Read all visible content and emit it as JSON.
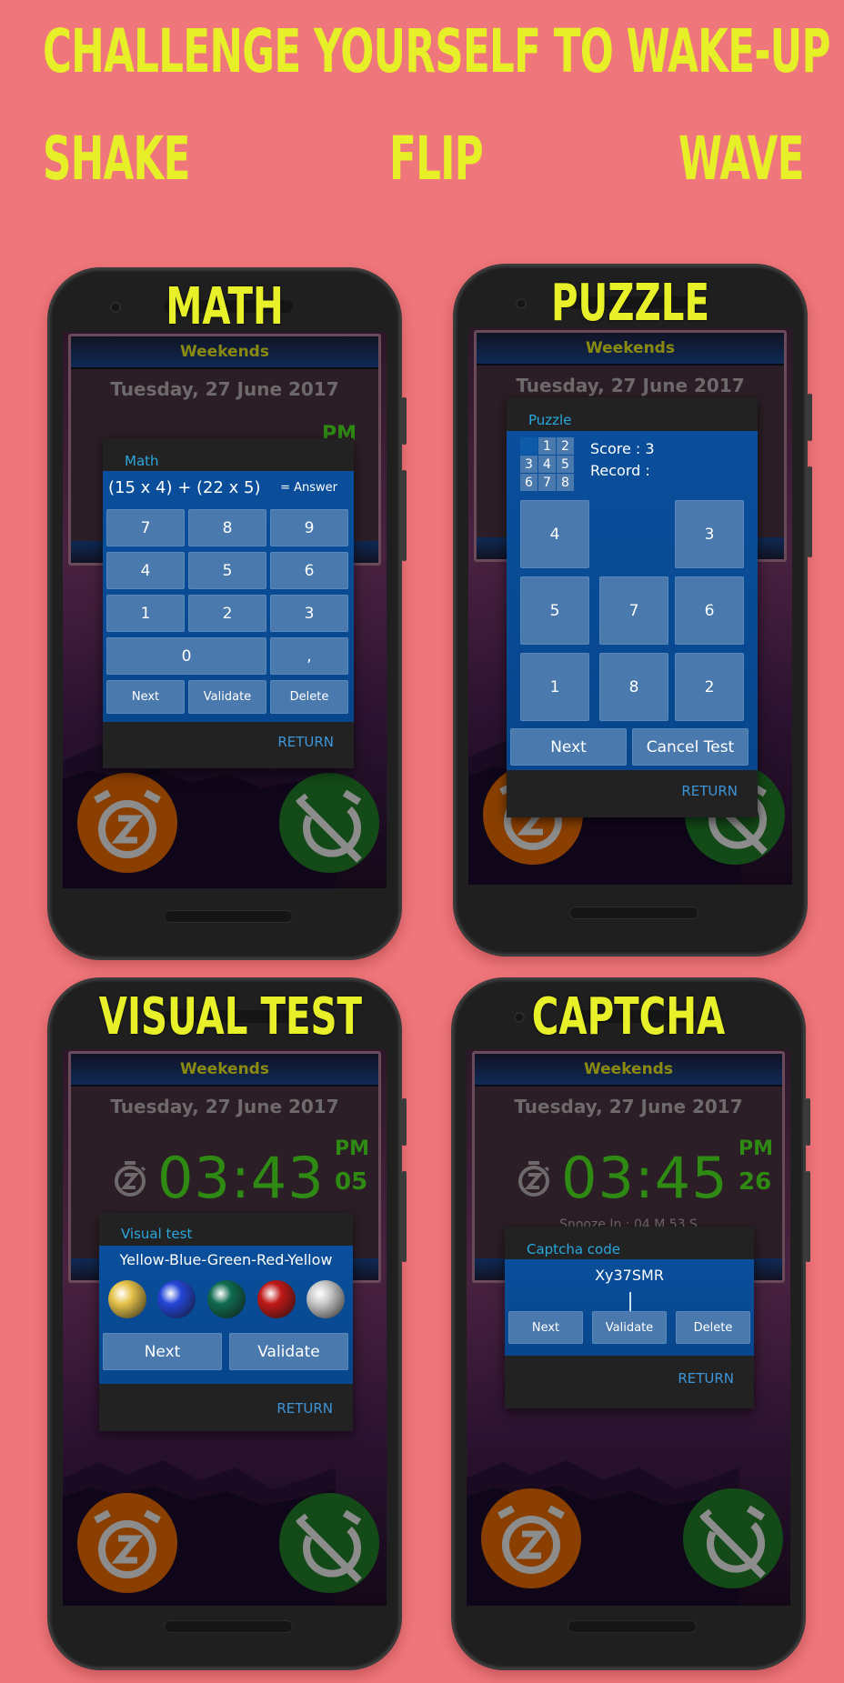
{
  "headline": {
    "title": "CHALLENGE YOURSELF TO WAKE-UP",
    "modes": [
      "SHAKE",
      "FLIP",
      "WAVE"
    ]
  },
  "colors": {
    "background": "#ef767b",
    "headline": "#e6ef27",
    "dialog_blue": "#0a4f9c",
    "key_blue": "#4a79ad",
    "clock_green": "#2e8a12",
    "link_blue": "#3e95d8",
    "snooze_orange": "#8a3f00",
    "dismiss_green": "#134a17"
  },
  "alarm_screen": {
    "header": "Weekends",
    "date": "Tuesday,  27  June  2017"
  },
  "phones": [
    {
      "label": "MATH",
      "clock": {
        "ampm": "PM"
      },
      "dialog": {
        "title": "Math",
        "expression": "(15 x 4) + (22 x 5)",
        "answer_placeholder": "=  Answer",
        "keys": [
          "7",
          "8",
          "9",
          "4",
          "5",
          "6",
          "1",
          "2",
          "3",
          "0",
          ","
        ],
        "actions": [
          "Next",
          "Validate",
          "Delete"
        ],
        "return_label": "RETURN"
      },
      "snooze_icon": "alarm-snooze-icon",
      "dismiss_icon": "alarm-off-icon"
    },
    {
      "label": "PUZZLE",
      "dialog": {
        "title": "Puzzle",
        "target_grid": [
          "",
          "1",
          "2",
          "3",
          "4",
          "5",
          "6",
          "7",
          "8"
        ],
        "score_label": "Score : 3",
        "record_label": "Record :",
        "tiles": [
          "4",
          "",
          "3",
          "5",
          "7",
          "6",
          "1",
          "8",
          "2"
        ],
        "actions": [
          "Next",
          "Cancel Test"
        ],
        "return_label": "RETURN"
      },
      "snooze_icon": "alarm-snooze-icon",
      "dismiss_icon": "alarm-off-icon"
    },
    {
      "label": "VISUAL TEST",
      "clock": {
        "time": "03:43",
        "ampm": "PM",
        "seconds": "05"
      },
      "dialog": {
        "title": "Visual test",
        "sequence": "Yellow-Blue-Green-Red-Yellow",
        "balls": [
          {
            "name": "yellow",
            "color": "#e6c24a"
          },
          {
            "name": "blue",
            "color": "#2446d8"
          },
          {
            "name": "green",
            "color": "#0f6b4f"
          },
          {
            "name": "red",
            "color": "#c01818"
          },
          {
            "name": "white",
            "color": "#c9c9c9"
          }
        ],
        "actions": [
          "Next",
          "Validate"
        ],
        "return_label": "RETURN"
      },
      "snooze_icon": "alarm-snooze-icon",
      "dismiss_icon": "alarm-off-icon"
    },
    {
      "label": "CAPTCHA",
      "clock": {
        "time": "03:45",
        "ampm": "PM",
        "seconds": "26"
      },
      "snooze_in": "Snooze In : 04 M 53 S",
      "dialog": {
        "title": "Captcha code",
        "code": "Xy37SMR",
        "input_value": "",
        "actions": [
          "Next",
          "Validate",
          "Delete"
        ],
        "return_label": "RETURN"
      },
      "snooze_icon": "alarm-snooze-icon",
      "dismiss_icon": "alarm-off-icon"
    }
  ]
}
